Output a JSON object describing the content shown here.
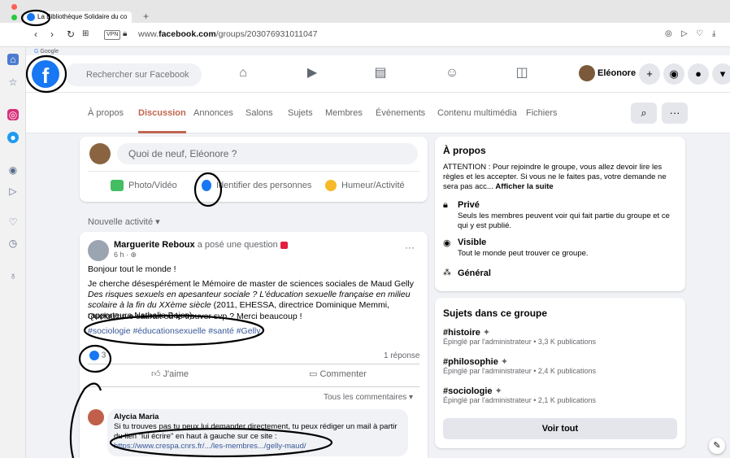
{
  "browser": {
    "tab_title": "La Bibliothèque Solidaire du co",
    "url_prefix": "www.",
    "url_domain": "facebook.com",
    "url_path": "/groups/203076931011047",
    "vpn_label": "VPN",
    "bookmark_label": "Google"
  },
  "header": {
    "logo": "f",
    "search_placeholder": "Rechercher sur Facebook",
    "profile_name": "Eléonore"
  },
  "group_tabs": [
    "À propos",
    "Discussion",
    "Annonces",
    "Salons",
    "Sujets",
    "Membres",
    "Évènements",
    "Contenu multimédia",
    "Fichiers"
  ],
  "group_tab_active": "Discussion",
  "composer": {
    "placeholder": "Quoi de neuf, Eléonore ?",
    "actions": [
      "Photo/Vidéo",
      "Identifier des personnes",
      "Humeur/Activité"
    ]
  },
  "feed_label": "Nouvelle activité ▾",
  "post": {
    "author": "Marguerite Reboux",
    "action_text": " a posé une question ",
    "time": "6 h · ",
    "line1": "Bonjour tout le monde !",
    "body_a": "Je cherche désespérément le Mémoire de master de sciences sociales de Maud Gelly ",
    "body_italic": "Des risques sexuels en apesanteur sociale ? L'éducation sexuelle française en milieu scolaire à la fin du XXème siècle",
    "body_b": " (2011, EHESSA, directrice Dominique Memmi, rapporteure Nathalie Bajos).",
    "question": "Quelqu'un.e saurait où le trouver svp ? Merci beaucoup !",
    "hashtags": "#sociologie #éducationsexuelle #santé #Gelly",
    "like_count": "3",
    "reply_count": "1 réponse",
    "like_label": "J'aime",
    "comment_label": "Commenter",
    "sort_label": "Tous les commentaires ▾",
    "comment": {
      "author": "Alycia Maria",
      "text": "Si tu trouves pas tu peux lui demander directement, tu peux rédiger un mail à partir du lien \"lui écrire\" en haut à gauche sur ce site :",
      "link": "https://www.crespa.cnrs.fr/.../les-membres.../gelly-maud/"
    }
  },
  "about": {
    "title": "À propos",
    "text_a": "ATTENTION : Pour rejoindre le groupe, vous allez devoir lire les règles et les accepter. Si vous ne le faites pas, votre demande ne sera pas acc... ",
    "more": "Afficher la suite",
    "private_title": "Privé",
    "private_desc": "Seuls les membres peuvent voir qui fait partie du groupe et ce qui y est publié.",
    "visible_title": "Visible",
    "visible_desc": "Tout le monde peut trouver ce groupe.",
    "general": "Général"
  },
  "topics": {
    "title": "Sujets dans ce groupe",
    "items": [
      {
        "name": "#histoire",
        "meta": "Épinglé par l'administrateur • 3,3 K publications"
      },
      {
        "name": "#philosophie",
        "meta": "Épinglé par l'administrateur • 2,4 K publications"
      },
      {
        "name": "#sociologie",
        "meta": "Épinglé par l'administrateur • 2,1 K publications"
      }
    ],
    "see_all": "Voir tout"
  },
  "colors": {
    "accent": "#c0664f",
    "fb_blue": "#1877f2",
    "link": "#385898"
  }
}
